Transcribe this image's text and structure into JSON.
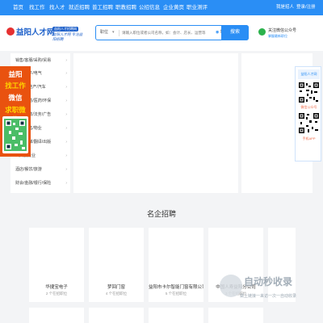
{
  "topnav": {
    "items": [
      "首页",
      "找工作",
      "找人才",
      "就近招聘",
      "普工招聘",
      "职教招聘",
      "公招信息",
      "企业黄页",
      "职业测评"
    ],
    "right": [
      "我是招人",
      "登录/注册"
    ]
  },
  "header": {
    "logo_name": "益阳人才网",
    "logo_badge": "益阳人才招聘网",
    "logo_slogan": "益阳人才网 专注益阳招聘",
    "search_type": "职位",
    "search_caret": "▾",
    "search_placeholder": "请输入职位或者公司名称，如：会计、店长、运营等",
    "map_label": "地图",
    "search_button": "搜索",
    "wechat_title": "关注微信公众号",
    "wechat_sub": "掌握最新职位"
  },
  "categories": [
    {
      "label": "销售/客服/采购/贸易"
    },
    {
      "label": "技术/电子/电气"
    },
    {
      "label": "建筑/房地产/汽车"
    },
    {
      "label": "生产/制造/医药/环保"
    },
    {
      "label": "人事/行政/法务/广告"
    },
    {
      "label": "服务/零售/物业"
    },
    {
      "label": "教育/传媒/翻译/出版"
    },
    {
      "label": "公共服务业"
    },
    {
      "label": "酒店/餐饮/旅游"
    },
    {
      "label": "财会/金融/银行/保险"
    }
  ],
  "left_ad": {
    "lines": [
      "益阳",
      "找工作",
      "微信",
      "求职微信"
    ]
  },
  "right_ad": {
    "logo": "益阳人才网",
    "label1": "微信公众号",
    "label2": "手机APP"
  },
  "section": {
    "title": "名企招聘"
  },
  "companies": [
    {
      "name": "华捷宝电子",
      "count": "2 个在招职位"
    },
    {
      "name": "梦回门窗",
      "count": "4 个在招职位"
    },
    {
      "name": "益阳市卡尔智能门窗有限公司",
      "count": "5 个在招职位"
    },
    {
      "name": "中国人寿益阳分公司",
      "count": "3 个在招职位"
    }
  ],
  "watermark": {
    "big": "自动秒收录",
    "small": "做上链接一来访一次一自动收录"
  }
}
